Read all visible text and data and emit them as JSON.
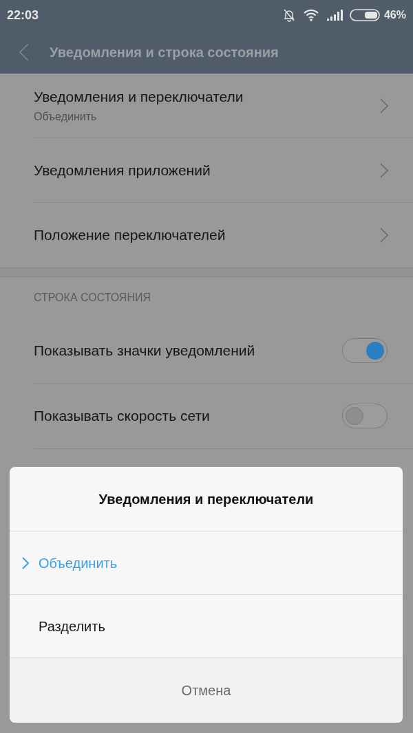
{
  "status_bar": {
    "time": "22:03",
    "battery": "46%"
  },
  "header": {
    "title": "Уведомления и строка состояния"
  },
  "items": [
    {
      "title": "Уведомления и переключатели",
      "subtitle": "Объединить"
    },
    {
      "title": "Уведомления приложений"
    },
    {
      "title": "Положение переключателей"
    }
  ],
  "section": {
    "title": "СТРОКА СОСТОЯНИЯ",
    "items": [
      {
        "kind": "toggle",
        "title": "Показывать значки уведомлений",
        "on": true
      },
      {
        "kind": "toggle",
        "title": "Показывать скорость сети",
        "on": false
      }
    ]
  },
  "dialog": {
    "title": "Уведомления и переключатели",
    "options": [
      {
        "label": "Объединить",
        "selected": true
      },
      {
        "label": "Разделить",
        "selected": false
      }
    ],
    "cancel": "Отмена"
  }
}
